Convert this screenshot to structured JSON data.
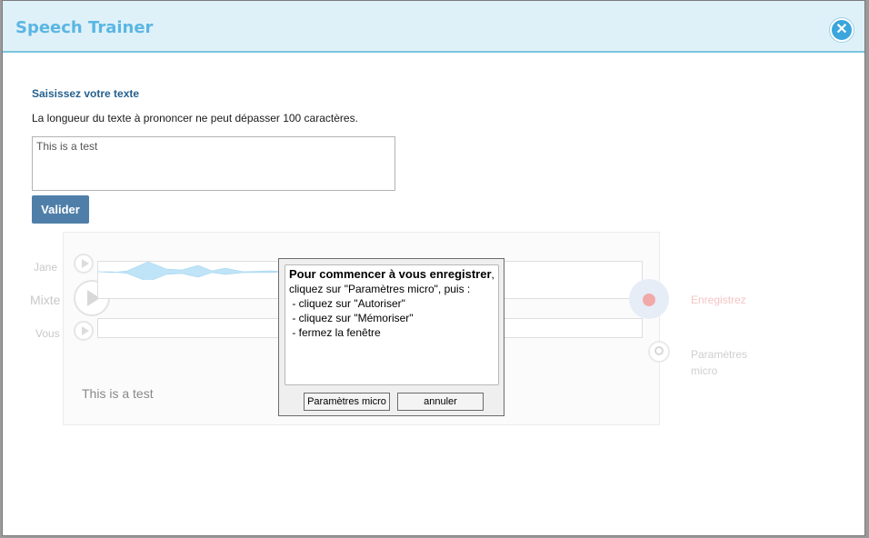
{
  "app": {
    "title": "Speech Trainer"
  },
  "form": {
    "section_label": "Saisissez votre texte",
    "info": "La longueur du texte à prononcer ne peut dépasser 100 caractères.",
    "text_value": "This is a test",
    "validate_label": "Valider"
  },
  "player": {
    "tracks": {
      "jane": "Jane",
      "mixte": "Mixte",
      "vous": "Vous"
    },
    "phrase": "This is a test",
    "record_label": "Enregistrez",
    "mic_settings_label": "Paramètres micro"
  },
  "dialog": {
    "heading": "Pour commencer à vous enregistrer",
    "heading_suffix": ",",
    "lines": [
      "cliquez sur \"Paramètres micro\", puis :",
      " - cliquez sur \"Autoriser\"",
      " - cliquez sur \"Mémoriser\"",
      " - fermez la fenêtre"
    ],
    "buttons": {
      "mic_settings": "Paramètres micro",
      "cancel": "annuler"
    }
  },
  "colors": {
    "header_bg": "#dff1f8",
    "title": "#5ab6e3",
    "accent_button": "#4f7fa8",
    "waveform": "#bfe3f7"
  }
}
